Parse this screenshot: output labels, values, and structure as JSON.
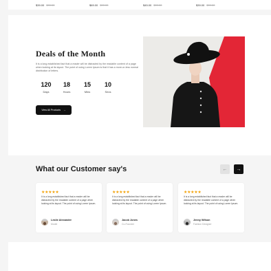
{
  "price_strip": {
    "items": [
      {
        "price": "$39.00",
        "old": "$99.00"
      },
      {
        "price": "$69.00",
        "old": "$99.00"
      },
      {
        "price": "$45.00",
        "old": "$99.00"
      },
      {
        "price": "$39.00",
        "old": "$99.00"
      }
    ]
  },
  "deals": {
    "title": "Deals of the Month",
    "description": "It is a long established fact that a reader will be distracted by the readable content of a page when looking at its layout. The point of using Lorem Ipsum is that it has a more-or-less normal distribution of letters.",
    "countdown": [
      {
        "value": "120",
        "label": "Days"
      },
      {
        "value": "18",
        "label": "Hours"
      },
      {
        "value": "15",
        "label": "Mins"
      },
      {
        "value": "10",
        "label": "Secs"
      }
    ],
    "button_label": "View All Products",
    "button_icon": "arrow-right-icon"
  },
  "testimonials": {
    "title": "What our Customer say's",
    "prev_icon": "chevron-left-icon",
    "next_icon": "chevron-right-icon",
    "cards": [
      {
        "stars": "★★★★★",
        "text": "It is a long established fact that a reader will be distracted by the readable content of a page when looking at its layout. The point of using Lorem Ipsum.",
        "name": "Leslie Alexander",
        "role": "Model"
      },
      {
        "stars": "★★★★★",
        "text": "It is a long established fact that a reader will be distracted by the readable content of a page when looking at its layout. The point of using Lorem Ipsum.",
        "name": "Jacob Jones",
        "role": "Co-Founder"
      },
      {
        "stars": "★★★★★",
        "text": "It is a long established fact that a reader will be distracted by the readable content of a page when looking at its layout. The point of using Lorem Ipsum.",
        "name": "Jenny Wilson",
        "role": "Fashion Designer"
      }
    ]
  },
  "colors": {
    "star": "#f2a20a",
    "button": "#111111",
    "accent_red": "#e32636"
  }
}
